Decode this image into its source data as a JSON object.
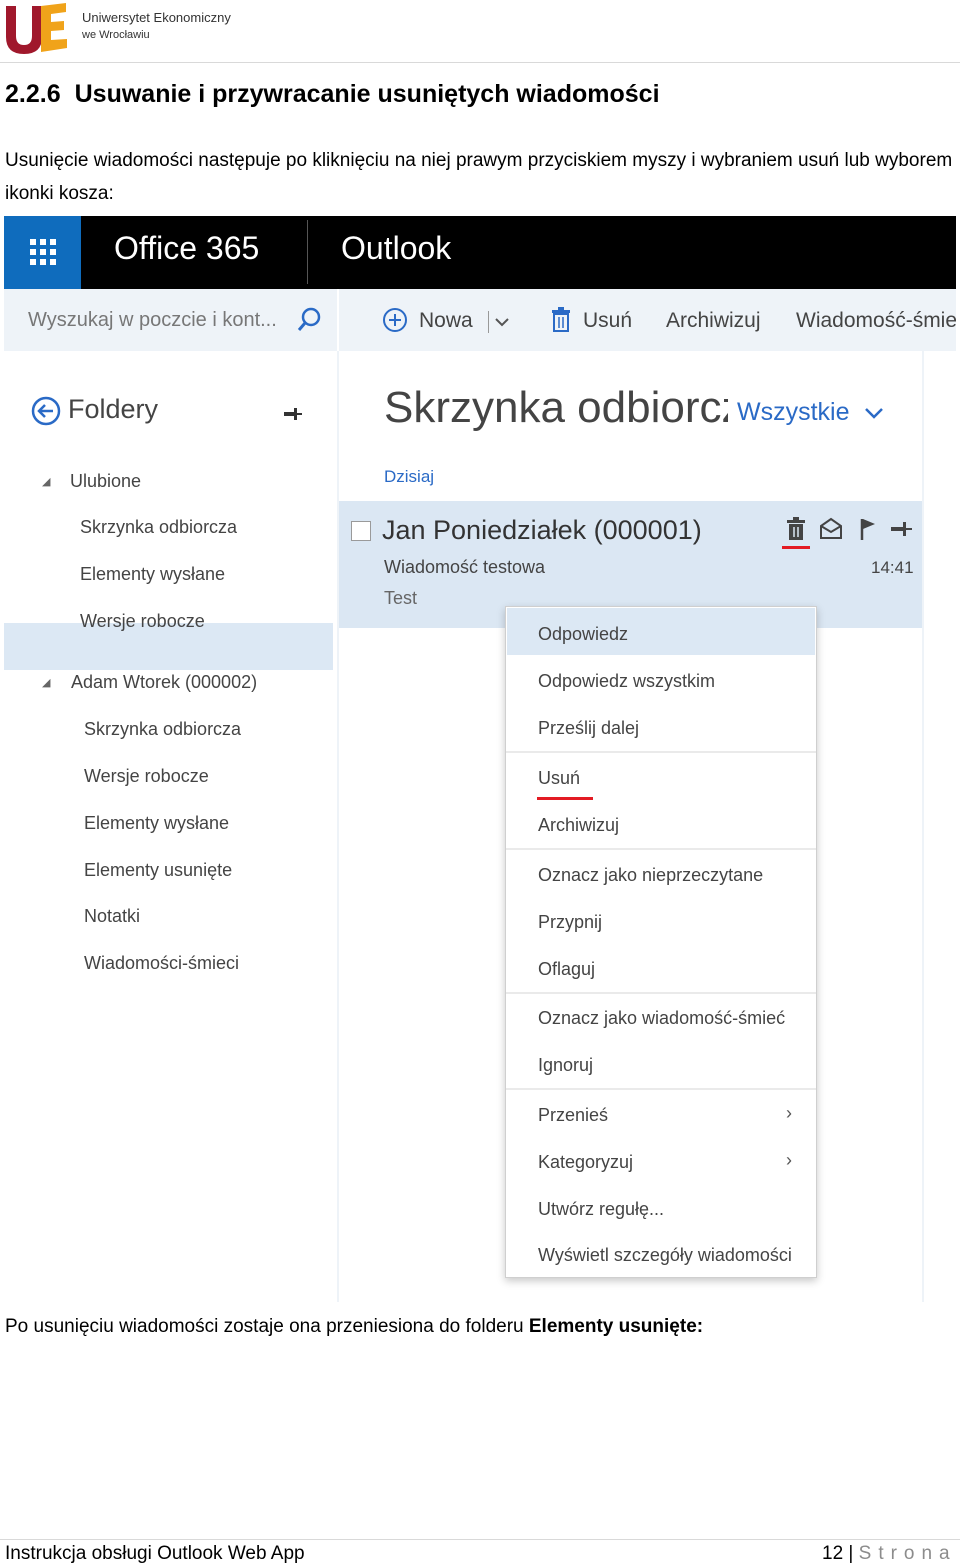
{
  "header": {
    "university_name": "Uniwersytet Ekonomiczny",
    "university_sub": "we Wrocławiu",
    "logo_text": "UE"
  },
  "section": {
    "number": "2.2.6",
    "title": "Usuwanie i przywracanie usuniętych wiadomości"
  },
  "intro_text": "Usunięcie wiadomości następuje po kliknięciu na niej prawym przyciskiem myszy i wybraniem usuń lub wyborem ikonki kosza:",
  "screenshot": {
    "app_launcher_icon": "waffle-icon",
    "brand_office": "Office 365",
    "brand_app": "Outlook",
    "search_placeholder": "Wyszukaj w poczcie i kont...",
    "toolbar": {
      "new_label": "Nowa",
      "delete_label": "Usuń",
      "archive_label": "Archiwizuj",
      "junk_label": "Wiadomość-śmie"
    },
    "folders": {
      "title": "Foldery",
      "favorites_label": "Ulubione",
      "favorites": [
        "Skrzynka odbiorcza",
        "Elementy wysłane",
        "Wersje robocze"
      ],
      "account_label": "Adam Wtorek (000002)",
      "account_folders": [
        "Skrzynka odbiorcza",
        "Wersje robocze",
        "Elementy wysłane",
        "Elementy usunięte",
        "Notatki",
        "Wiadomości-śmieci"
      ]
    },
    "mail_list": {
      "title": "Skrzynka odbiorcza",
      "filter": "Wszystkie",
      "group_label": "Dzisiaj"
    },
    "message": {
      "sender": "Jan Poniedziałek (000001)",
      "subject": "Wiadomość testowa",
      "preview": "Test",
      "time": "14:41"
    },
    "context_menu": {
      "reply": "Odpowiedz",
      "reply_all": "Odpowiedz wszystkim",
      "forward": "Prześlij dalej",
      "delete": "Usuń",
      "archive": "Archiwizuj",
      "mark_unread": "Oznacz jako nieprzeczytane",
      "pin": "Przypnij",
      "flag": "Oflaguj",
      "mark_junk": "Oznacz jako wiadomość-śmieć",
      "ignore": "Ignoruj",
      "move": "Przenieś",
      "categorize": "Kategoryzuj",
      "create_rule": "Utwórz regułę...",
      "show_details": "Wyświetl szczegóły wiadomości"
    },
    "highlight_color": "#e31b23"
  },
  "after_text": {
    "prefix": "Po usunięciu wiadomości zostaje ona przeniesiona do folderu ",
    "bold": "Elementy usunięte:"
  },
  "footer": {
    "left": "Instrukcja obsługi Outlook Web App",
    "page_number": "12",
    "separator": "|",
    "page_word": "Strona"
  }
}
